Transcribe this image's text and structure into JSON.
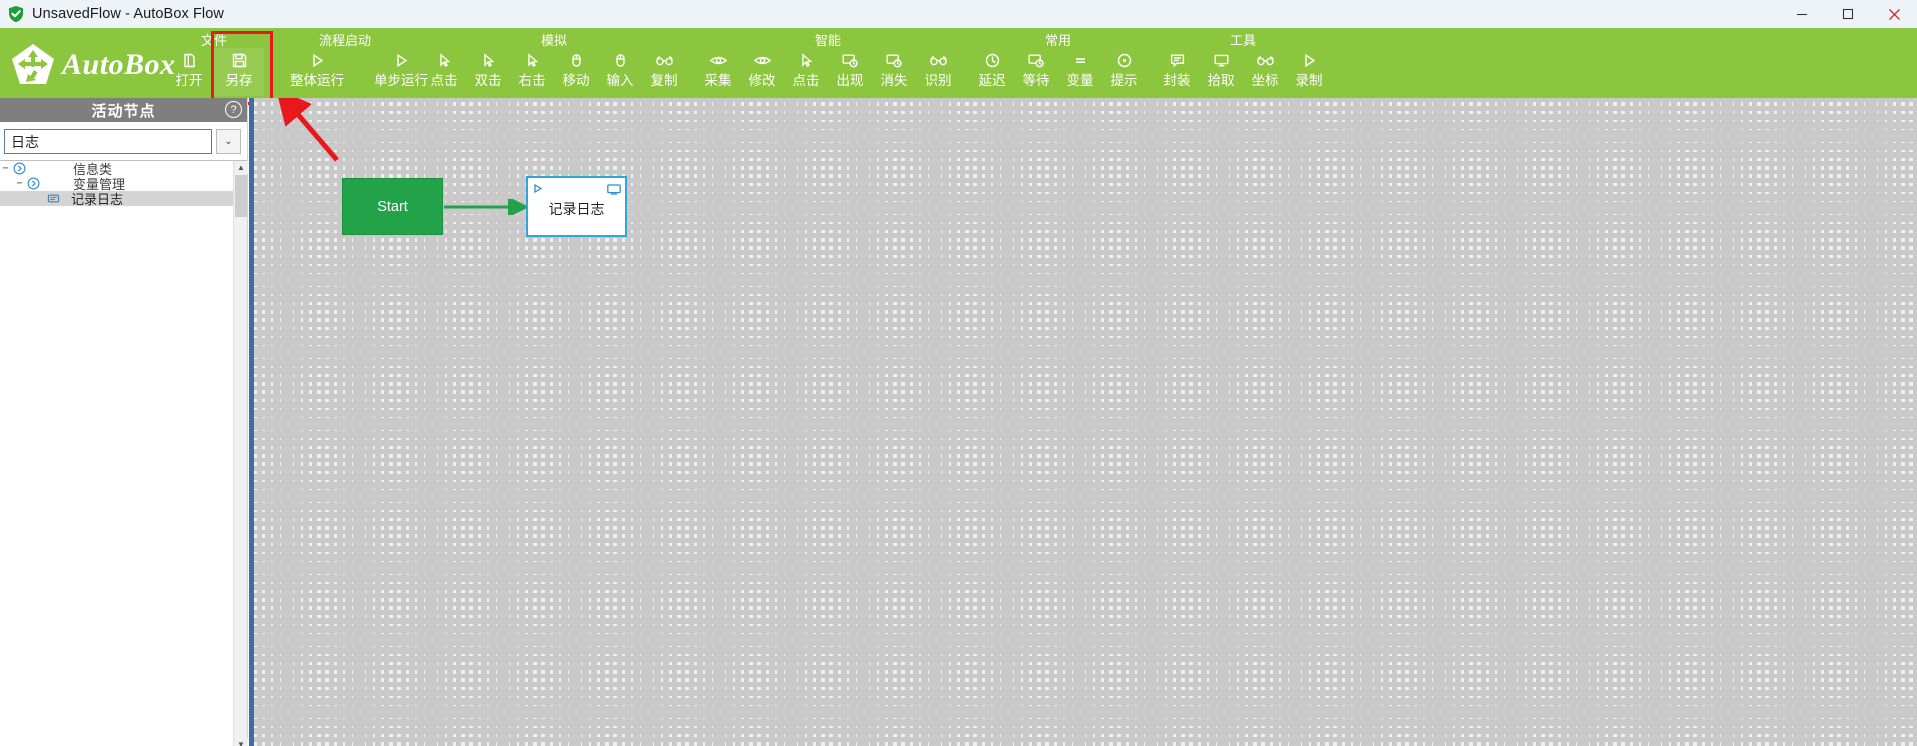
{
  "window": {
    "title": "UnsavedFlow - AutoBox Flow",
    "icon": "shield-check-icon",
    "controls": {
      "minimize": "minimize-icon",
      "maximize": "maximize-icon",
      "close": "close-icon"
    }
  },
  "brand": {
    "name": "AutoBox",
    "mark": "pentagon-arrows-icon",
    "color": "#8cc63e"
  },
  "ribbon": {
    "background": "#8cc63e",
    "highlight_color": "#e8191c",
    "groups": [
      {
        "title": "文件",
        "items": [
          {
            "label": "打开",
            "icon": "open-file-icon",
            "highlighted": false
          },
          {
            "label": "另存",
            "icon": "save-as-icon",
            "highlighted": true
          }
        ]
      },
      {
        "title": "流程启动",
        "items": [
          {
            "label": "整体运行",
            "icon": "play-icon",
            "highlighted": false
          },
          {
            "label": "单步运行",
            "icon": "play-icon",
            "highlighted": false
          }
        ]
      },
      {
        "title": "模拟",
        "items": [
          {
            "label": "点击",
            "icon": "cursor-icon",
            "highlighted": false
          },
          {
            "label": "双击",
            "icon": "cursor-icon",
            "highlighted": false
          },
          {
            "label": "右击",
            "icon": "cursor-icon",
            "highlighted": false
          },
          {
            "label": "移动",
            "icon": "mouse-icon",
            "highlighted": false
          },
          {
            "label": "输入",
            "icon": "mouse-icon",
            "highlighted": false
          },
          {
            "label": "复制",
            "icon": "glasses-icon",
            "highlighted": false
          }
        ]
      },
      {
        "title": "智能",
        "items": [
          {
            "label": "采集",
            "icon": "eye-icon",
            "highlighted": false
          },
          {
            "label": "修改",
            "icon": "eye-icon",
            "highlighted": false
          },
          {
            "label": "点击",
            "icon": "cursor-icon",
            "highlighted": false
          },
          {
            "label": "出现",
            "icon": "clock-screen-icon",
            "highlighted": false
          },
          {
            "label": "消失",
            "icon": "clock-screen-icon",
            "highlighted": false
          },
          {
            "label": "识别",
            "icon": "glasses-icon",
            "highlighted": false
          }
        ]
      },
      {
        "title": "常用",
        "items": [
          {
            "label": "延迟",
            "icon": "clock-icon",
            "highlighted": false
          },
          {
            "label": "等待",
            "icon": "clock-screen-icon",
            "highlighted": false
          },
          {
            "label": "变量",
            "icon": "equals-icon",
            "highlighted": false
          },
          {
            "label": "提示",
            "icon": "info-circle-icon",
            "highlighted": false
          }
        ]
      },
      {
        "title": "工具",
        "items": [
          {
            "label": "封装",
            "icon": "comment-box-icon",
            "highlighted": false
          },
          {
            "label": "拾取",
            "icon": "monitor-icon",
            "highlighted": false
          },
          {
            "label": "坐标",
            "icon": "glasses-icon",
            "highlighted": false
          },
          {
            "label": "录制",
            "icon": "play-icon",
            "highlighted": false
          }
        ]
      }
    ]
  },
  "sidebar": {
    "header": {
      "title": "活动节点",
      "help_icon": "question-mark-icon",
      "help_label": "?"
    },
    "search": {
      "value": "日志",
      "placeholder": "",
      "dropdown_icon": "chevron-down-icon",
      "dropdown_label": "⌄"
    },
    "tree": [
      {
        "label": "信息类",
        "level": 1,
        "expander": "−",
        "icon": "chevron-circle-icon",
        "selected": false
      },
      {
        "label": "变量管理",
        "level": 2,
        "expander": "−",
        "icon": "chevron-circle-icon",
        "selected": false
      },
      {
        "label": "记录日志",
        "level": 3,
        "expander": "",
        "icon": "note-icon",
        "selected": true
      }
    ],
    "scrollbar": {
      "up": "▲",
      "down": "▼"
    }
  },
  "canvas": {
    "nodes": [
      {
        "id": "start",
        "label": "Start",
        "type": "start",
        "color": "#22a34a"
      },
      {
        "id": "log",
        "label": "记录日志",
        "type": "activity",
        "border_color": "#2fa4dd",
        "header_icons": [
          "play-icon",
          "monitor-icon"
        ]
      }
    ],
    "connector": {
      "from": "start",
      "to": "log",
      "color": "#22a34a",
      "arrow": "arrow-right-icon"
    },
    "annotation": {
      "type": "red-arrow",
      "color": "#e8191c",
      "points_to": "另存"
    }
  }
}
